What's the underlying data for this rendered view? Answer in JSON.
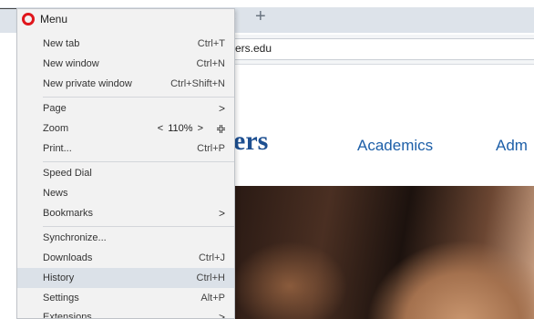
{
  "browser": {
    "tab_close_fragment": "×",
    "new_tab_symbol": "+",
    "url_fragment": "ers.edu"
  },
  "page": {
    "logo_fragment": "ers",
    "nav": {
      "academics": "Academics",
      "admissions_fragment": "Adm"
    }
  },
  "menu": {
    "title": "Menu",
    "logo_color": "#e0161c",
    "items": {
      "new_tab": {
        "label": "New tab",
        "shortcut": "Ctrl+T"
      },
      "new_window": {
        "label": "New window",
        "shortcut": "Ctrl+N"
      },
      "new_private_window": {
        "label": "New private window",
        "shortcut": "Ctrl+Shift+N"
      },
      "page": {
        "label": "Page",
        "arrow": ">"
      },
      "zoom": {
        "label": "Zoom",
        "decrease": "<",
        "value": "110%",
        "increase": ">"
      },
      "print": {
        "label": "Print...",
        "shortcut": "Ctrl+P"
      },
      "speed_dial": {
        "label": "Speed Dial"
      },
      "news": {
        "label": "News"
      },
      "bookmarks": {
        "label": "Bookmarks",
        "arrow": ">"
      },
      "synchronize": {
        "label": "Synchronize..."
      },
      "downloads": {
        "label": "Downloads",
        "shortcut": "Ctrl+J"
      },
      "history": {
        "label": "History",
        "shortcut": "Ctrl+H"
      },
      "settings": {
        "label": "Settings",
        "shortcut": "Alt+P"
      },
      "extensions": {
        "label": "Extensions",
        "arrow": ">"
      }
    },
    "highlighted_item": "history"
  }
}
